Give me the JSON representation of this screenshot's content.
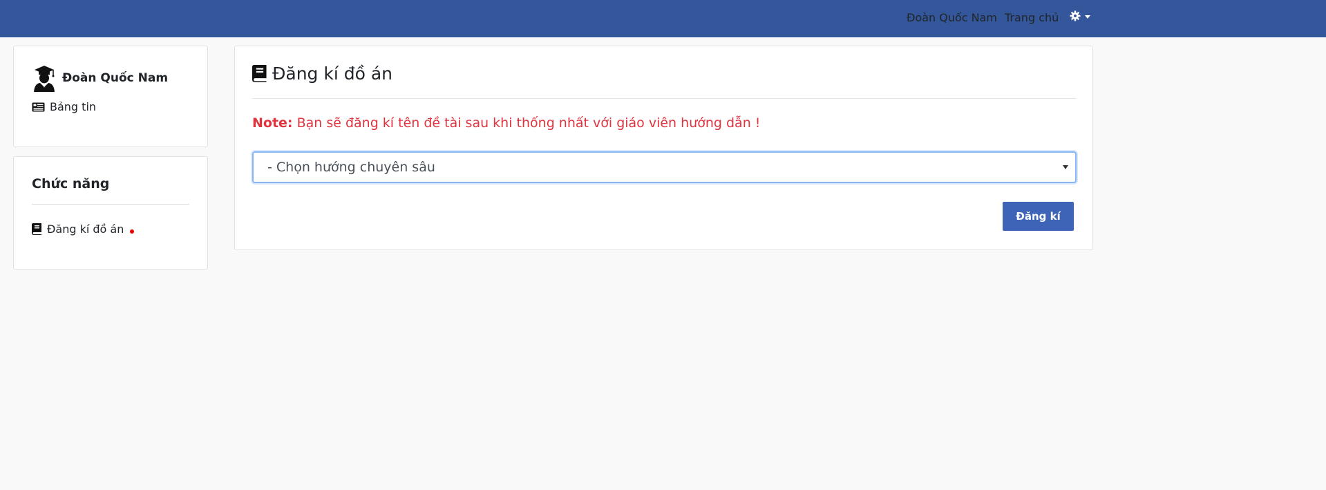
{
  "topbar": {
    "user_name": "Đoàn Quốc Nam",
    "home_label": "Trang chủ",
    "settings_icon": "gear-icon",
    "bg_color": "#34579b"
  },
  "profile": {
    "name": "Đoàn Quốc Nam",
    "avatar_icon": "graduate-avatar-icon",
    "news_label": "Bảng tin",
    "news_icon": "newspaper-icon"
  },
  "functions": {
    "title": "Chức năng",
    "items": [
      {
        "label": "Đăng kí đồ án",
        "icon": "book-icon",
        "has_notification_dot": true
      }
    ]
  },
  "main": {
    "title": "Đăng kí đồ án",
    "title_icon": "book-icon",
    "note_label": "Note:",
    "note_text": " Bạn sẽ đăng kí tên đề tài sau khi thống nhất với giáo viên hướng dẫn !",
    "select": {
      "selected": "- Chọn hướng chuyên sâu"
    },
    "submit_label": "Đăng kí",
    "accent_color": "#3e64b8",
    "note_color": "#e0343f"
  }
}
